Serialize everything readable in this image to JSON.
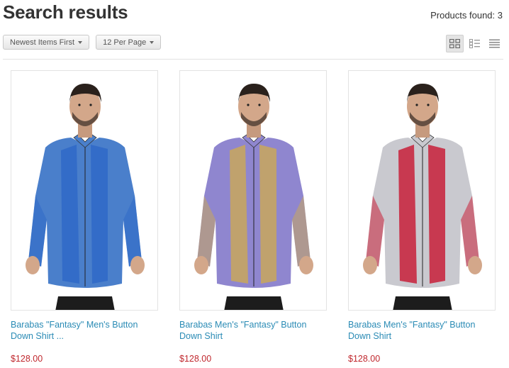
{
  "header": {
    "title": "Search results",
    "products_found": "Products found: 3"
  },
  "toolbar": {
    "sort_label": "Newest Items First",
    "per_page_label": "12 Per Page"
  },
  "view_modes": [
    "grid-view-icon",
    "list-view-icon",
    "compact-list-icon"
  ],
  "products": [
    {
      "title": "Barabas \"Fantasy\" Men's Button Down Shirt ...",
      "price": "$128.00",
      "shirt_color": "#4a7fcb",
      "stripe_color": "#2f69c8"
    },
    {
      "title": "Barabas Men's \"Fantasy\" Button Down Shirt",
      "price": "$128.00",
      "shirt_color": "#8f86cf",
      "stripe_color": "#c9a75c"
    },
    {
      "title": "Barabas Men's \"Fantasy\" Button Down Shirt",
      "price": "$128.00",
      "shirt_color": "#c9c9cf",
      "stripe_color": "#c8203a"
    }
  ]
}
